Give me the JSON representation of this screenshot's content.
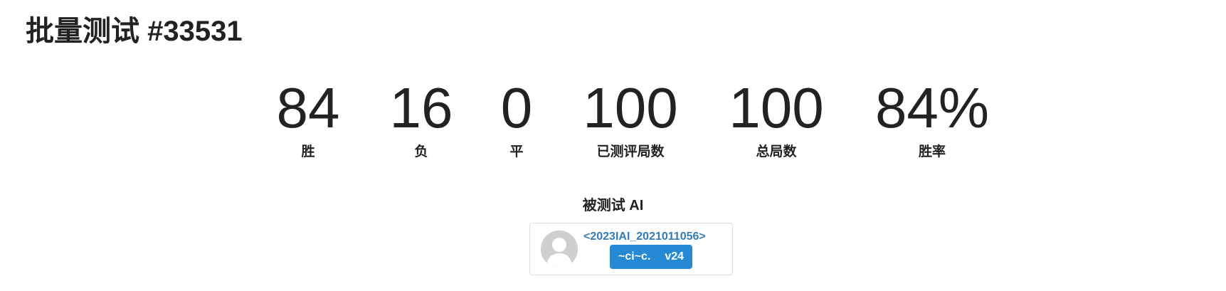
{
  "page": {
    "title": "批量测试 #33531"
  },
  "stats": [
    {
      "value": "84",
      "label": "胜"
    },
    {
      "value": "16",
      "label": "负"
    },
    {
      "value": "0",
      "label": "平"
    },
    {
      "value": "100",
      "label": "已测评局数"
    },
    {
      "value": "100",
      "label": "总局数"
    },
    {
      "value": "84%",
      "label": "胜率"
    }
  ],
  "tested_ai": {
    "section_label": "被测试 AI",
    "name": "<2023IAI_2021011056>",
    "badge_name": "~ci~c.",
    "badge_version": "v24",
    "avatar_icon": "default-user-avatar-icon"
  },
  "colors": {
    "link": "#337ab7",
    "badge_bg": "#2589d4",
    "avatar": "#cfcfcf"
  }
}
